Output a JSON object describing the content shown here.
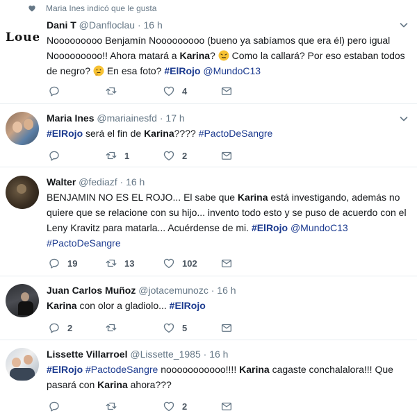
{
  "social_context": {
    "text": "Maria Ines indicó que le gusta",
    "icon": "heart-icon"
  },
  "tweets": [
    {
      "name": "Dani T",
      "handle": "@Danfloclau",
      "time": "16 h",
      "avatar_text": "Loue",
      "text": {
        "p1": "Nooooooooo Benjamín Nooooooooo (bueno ya sabíamos que era él) pero igual Nooooooooo!! Ahora matará a ",
        "karina": "Karina",
        "p2": "? ",
        "p3": " Como la callará? Por eso estaban todos de negro? ",
        "p4": " En esa foto? ",
        "hashtag1": "#ElRojo",
        "mention": "@MundoC13"
      },
      "replies": "",
      "retweets": "",
      "likes": "4"
    },
    {
      "name": "Maria Ines",
      "handle": "@mariainesfd",
      "time": "17 h",
      "text": {
        "hashtag1": "#ElRojo",
        "p1": " será el fin de ",
        "karina": "Karina",
        "p2": "???? ",
        "hashtag2": "#PactoDeSangre"
      },
      "replies": "",
      "retweets": "1",
      "likes": "2"
    },
    {
      "name": "Walter",
      "handle": "@fediazf",
      "time": "16 h",
      "text": {
        "p1": "BENJAMIN NO ES EL ROJO... El sabe que ",
        "karina": "Karina",
        "p2": " está investigando, además no quiere que se relacione con su hijo... invento todo esto y se puso de acuerdo con el Leny Kravitz para matarla... Acuérdense de mi. ",
        "hashtag1": "#ElRojo",
        "mention": "@MundoC13",
        "hashtag2": "#PactoDeSangre"
      },
      "replies": "19",
      "retweets": "13",
      "likes": "102"
    },
    {
      "name": "Juan Carlos Muñoz",
      "handle": "@jotacemunozc",
      "time": "16 h",
      "text": {
        "karina": "Karina",
        "p1": " con olor a gladiolo... ",
        "hashtag1": "#ElRojo"
      },
      "replies": "2",
      "retweets": "",
      "likes": "5"
    },
    {
      "name": "Lissette Villarroel",
      "handle": "@Lissette_1985",
      "time": "16 h",
      "text": {
        "hashtag1": "#ElRojo",
        "hashtag2": "#PactodeSangre",
        "p1": "  nooooooooooo!!!! ",
        "karina": "Karina",
        "p2": " cagaste conchalalora!!! Que pasará  con ",
        "karina2": "Karina",
        "p3": " ahora???"
      },
      "replies": "",
      "retweets": "",
      "likes": "2"
    }
  ],
  "header_separator": "·",
  "colors": {
    "link": "#1b3a8f",
    "muted": "#657786",
    "divider": "#e6ecf0"
  }
}
